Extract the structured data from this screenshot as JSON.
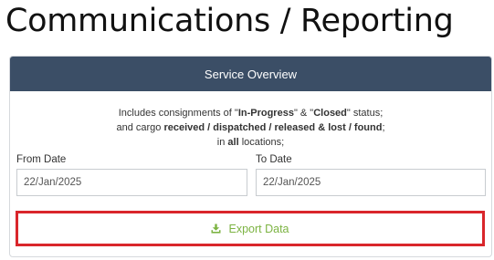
{
  "page": {
    "title": "Communications / Reporting"
  },
  "panel": {
    "header": "Service Overview",
    "description": {
      "l1_a": "Includes consignments of \"",
      "l1_b": "In-Progress",
      "l1_c": "\" & \"",
      "l1_d": "Closed",
      "l1_e": "\" status;",
      "l2_a": "and cargo ",
      "l2_b": "received / dispatched / released & lost / found",
      "l2_c": ";",
      "l3_a": "in ",
      "l3_b": "all",
      "l3_c": " locations;"
    },
    "from_label": "From Date",
    "from_value": "22/Jan/2025",
    "to_label": "To Date",
    "to_value": "22/Jan/2025",
    "export_label": "Export Data",
    "export_icon": "download-icon"
  },
  "colors": {
    "header_bg": "#3b4e66",
    "export_text": "#7cb342",
    "highlight_border": "#d9262b"
  }
}
